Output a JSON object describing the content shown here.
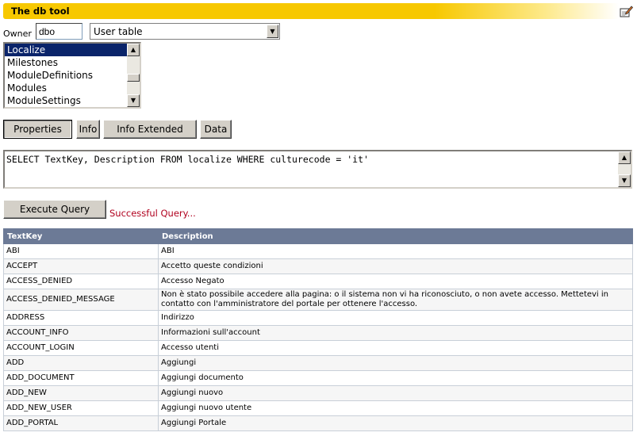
{
  "header": {
    "title": "The db tool",
    "edit_icon": "edit-pencil-icon"
  },
  "owner": {
    "label": "Owner",
    "value": "dbo"
  },
  "object_type": {
    "selected": "User table"
  },
  "table_list": {
    "items": [
      "Localize",
      "Milestones",
      "ModuleDefinitions",
      "Modules",
      "ModuleSettings"
    ],
    "selected": "Localize"
  },
  "tabs": [
    {
      "label": "Properties"
    },
    {
      "label": "Info"
    },
    {
      "label": "Info Extended"
    },
    {
      "label": "Data"
    }
  ],
  "query": {
    "text": "SELECT TextKey, Description FROM localize WHERE culturecode = 'it'"
  },
  "execute_label": "Execute Query",
  "status": "Successful Query...",
  "results": {
    "columns": [
      "TextKey",
      "Description"
    ],
    "rows": [
      {
        "key": "ABI",
        "desc": "ABI"
      },
      {
        "key": "ACCEPT",
        "desc": "Accetto queste condizioni"
      },
      {
        "key": "ACCESS_DENIED",
        "desc": "Accesso Negato"
      },
      {
        "key": "ACCESS_DENIED_MESSAGE",
        "desc": "Non è stato possibile accedere alla pagina: o il sistema non vi ha riconosciuto, o non avete accesso. Mettetevi in contatto con l'amministratore del portale per ottenere l'accesso."
      },
      {
        "key": "ADDRESS",
        "desc": "Indirizzo"
      },
      {
        "key": "ACCOUNT_INFO",
        "desc": "Informazioni sull'account"
      },
      {
        "key": "ACCOUNT_LOGIN",
        "desc": "Accesso utenti"
      },
      {
        "key": "ADD",
        "desc": "Aggiungi"
      },
      {
        "key": "ADD_DOCUMENT",
        "desc": "Aggiungi documento"
      },
      {
        "key": "ADD_NEW",
        "desc": "Aggiungi nuovo"
      },
      {
        "key": "ADD_NEW_USER",
        "desc": "Aggiungi nuovo utente"
      },
      {
        "key": "ADD_PORTAL",
        "desc": "Aggiungi Portale"
      }
    ]
  }
}
